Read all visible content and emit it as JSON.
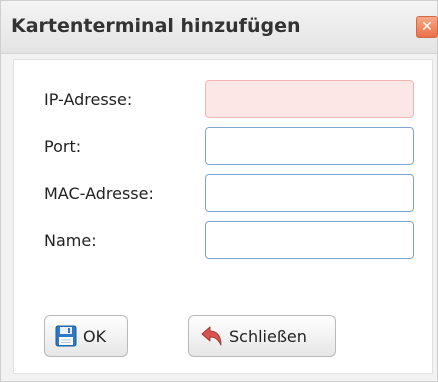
{
  "dialog": {
    "title": "Kartenterminal hinzufügen",
    "close_glyph": "✕"
  },
  "form": {
    "ip_label": "IP-Adresse:",
    "ip_value": "",
    "port_label": "Port:",
    "port_value": "",
    "mac_label": "MAC-Adresse:",
    "mac_value": "",
    "name_label": "Name:",
    "name_value": ""
  },
  "buttons": {
    "ok_label": "OK",
    "ok_icon": "save-icon",
    "close_label": "Schließen",
    "close_icon": "undo-arrow-icon"
  },
  "colors": {
    "close_button": "#ea7048",
    "invalid_field_bg": "#fde6e6",
    "field_border": "#7fa6d1"
  }
}
